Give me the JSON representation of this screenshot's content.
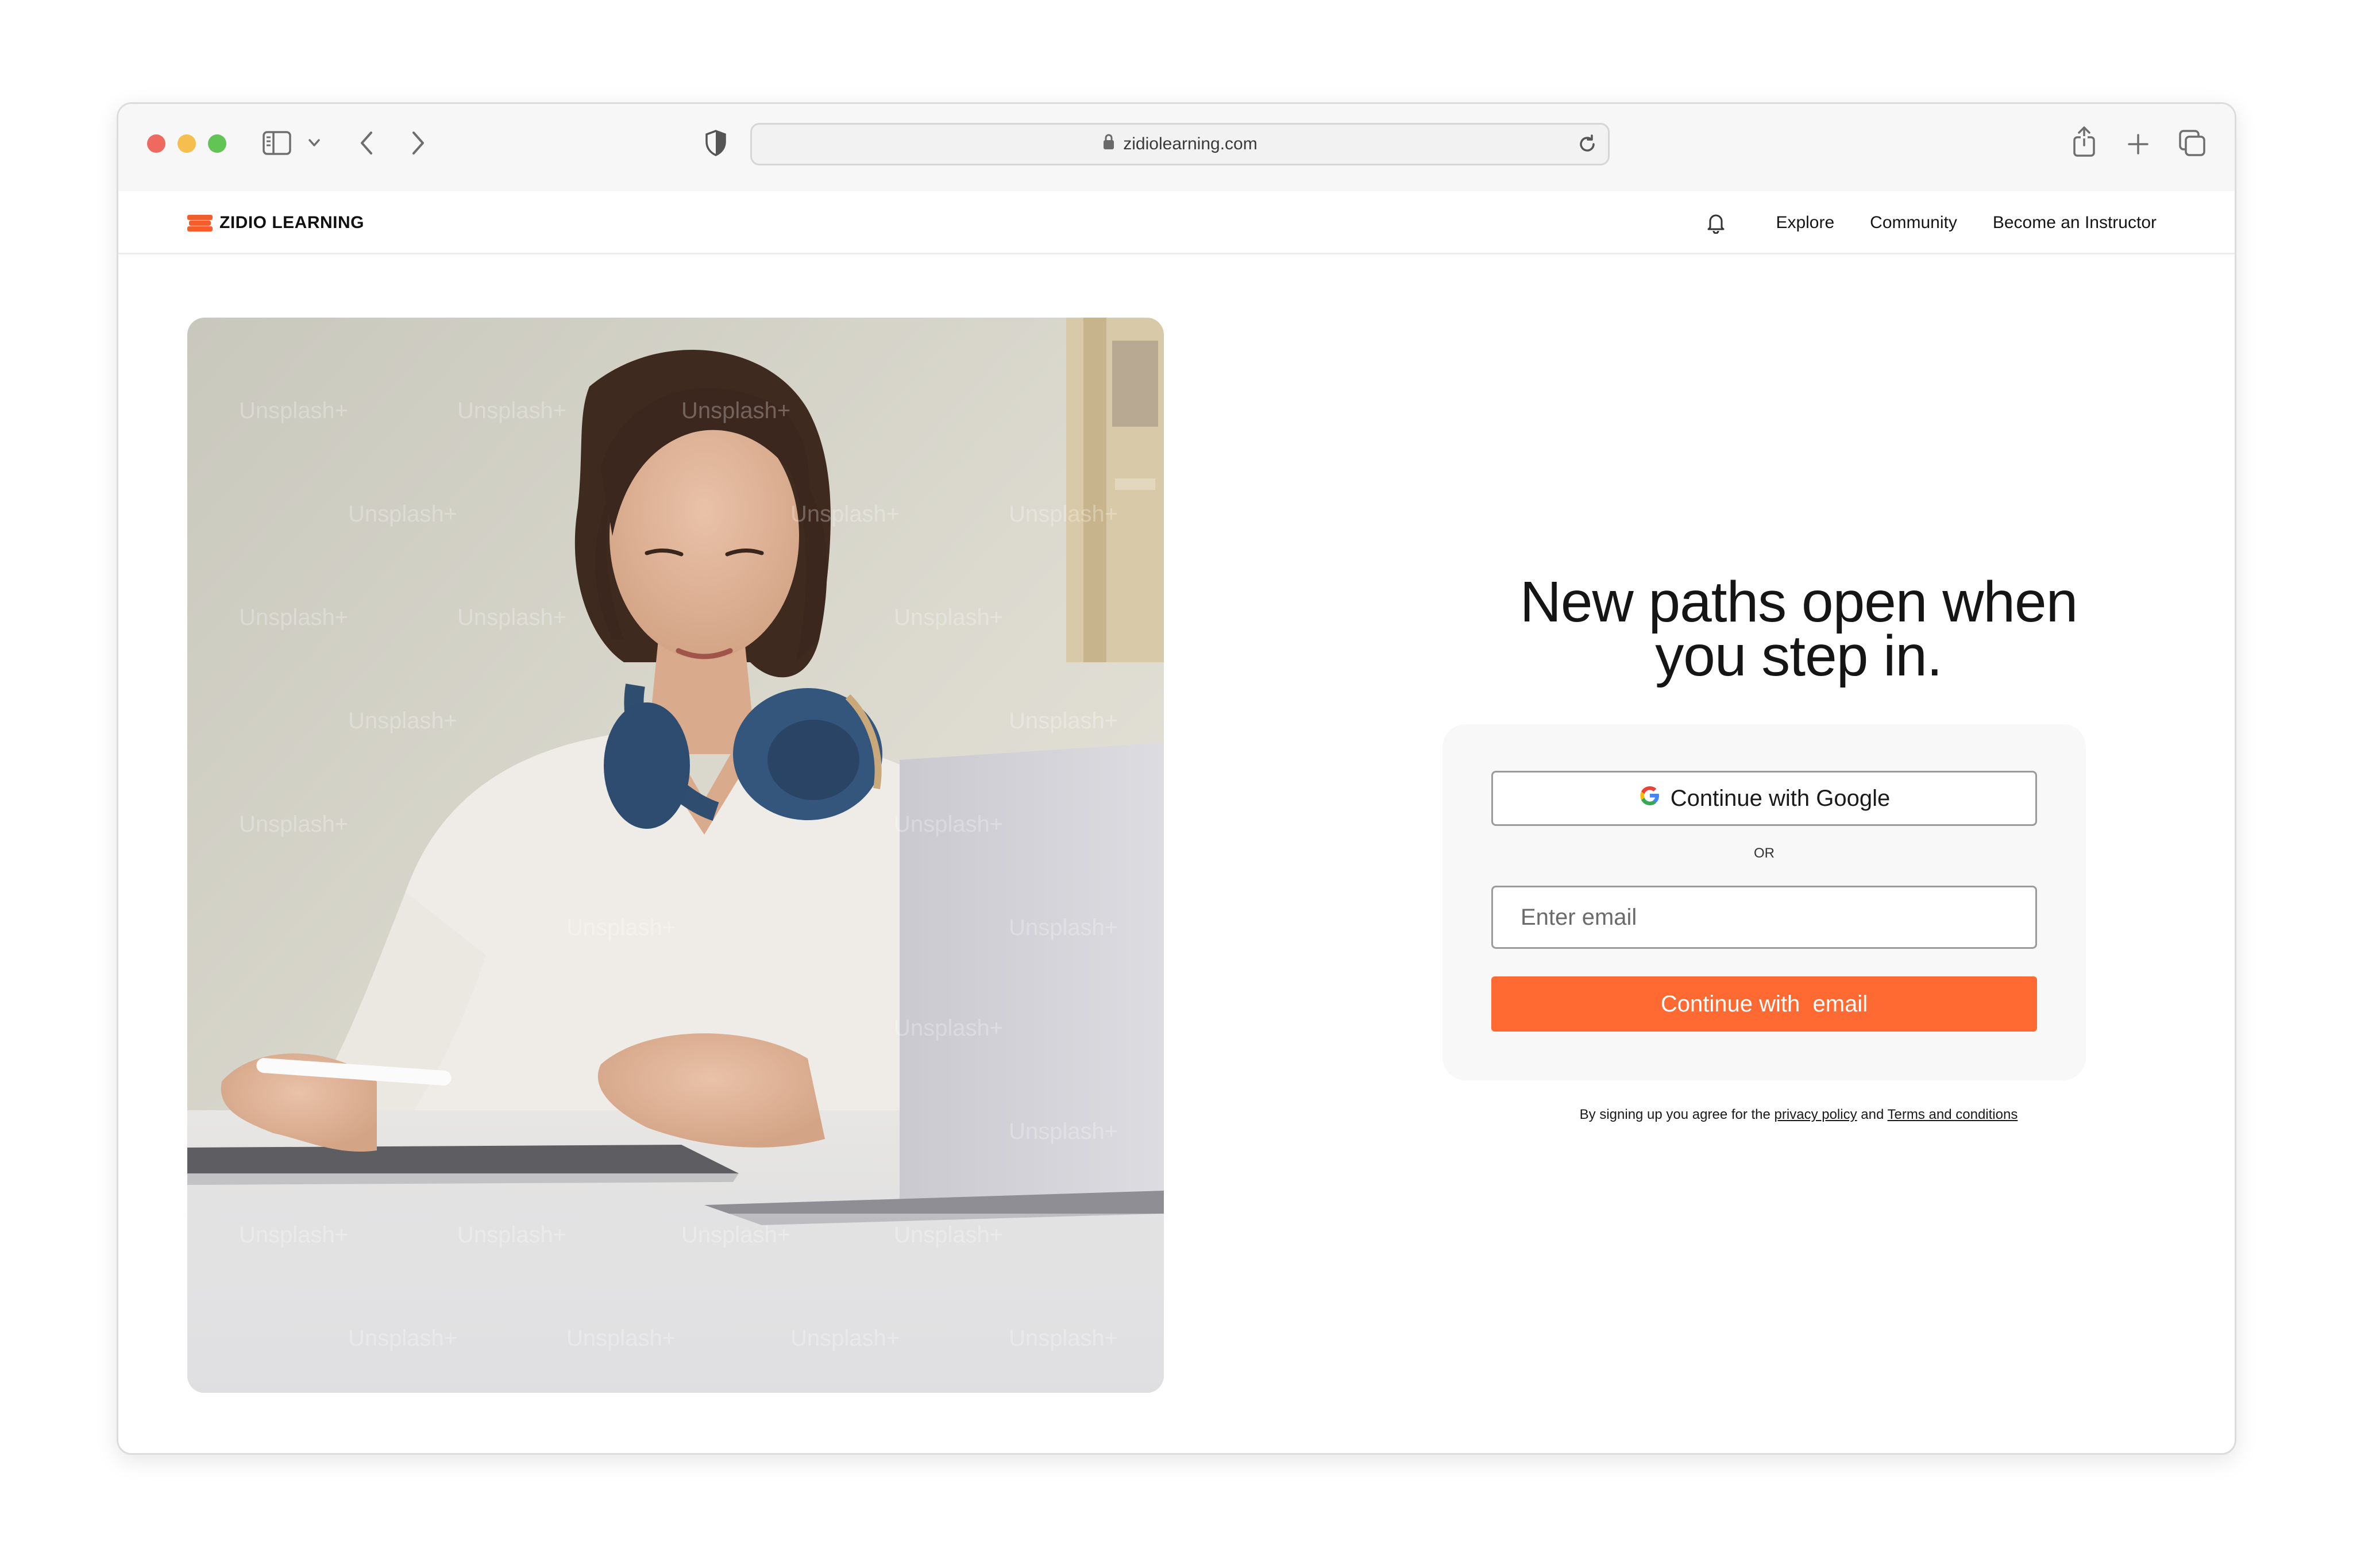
{
  "browser": {
    "url": "zidiolearning.com",
    "icons": [
      "sidebar-icon",
      "chevron-down-icon",
      "back-icon",
      "forward-icon",
      "shield-icon",
      "lock-icon",
      "reload-icon",
      "share-icon",
      "plus-icon",
      "tabs-icon"
    ]
  },
  "nav": {
    "logo_text": "ZIDIO LEARNING",
    "links": [
      "Explore",
      "Community",
      "Become an Instructor"
    ],
    "bell_icon": "bell-icon"
  },
  "hero": {
    "watermark": "Unsplash+"
  },
  "login": {
    "headline_line1": "New paths open when",
    "headline_line2": "you step in.",
    "google_button": "Continue with Google",
    "or_text": "OR",
    "email_placeholder": "Enter email",
    "email_button": "Continue with  email",
    "terms_prefix": "By signing up you agree for the",
    "privacy_link": "privacy policy",
    "terms_and": "and",
    "terms_link": "Terms and conditions"
  },
  "colors": {
    "accent": "#ff6a33",
    "logo": "#f45e2b",
    "traffic_red": "#ee6a5f",
    "traffic_yellow": "#f5be4f",
    "traffic_green": "#62c454"
  }
}
